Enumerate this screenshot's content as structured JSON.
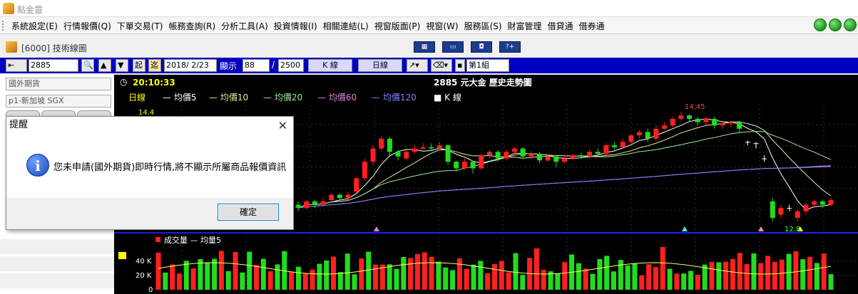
{
  "app": {
    "title": "點金靈"
  },
  "menu": {
    "items": [
      "系統設定(E)",
      "行情報價(Q)",
      "下單交易(T)",
      "帳務查詢(R)",
      "分析工具(A)",
      "投資情報(I)",
      "相關連結(L)",
      "視窗版面(P)",
      "視窗(W)",
      "服務區(S)",
      "財富管理",
      "借貸通",
      "借券通"
    ]
  },
  "window": {
    "title": "[6000] 技術線圖"
  },
  "toolbar": {
    "symbol": "2885",
    "btn_start": "起",
    "btn_recent": "迄",
    "date": "2018/ 2/23",
    "display_label": "顯示",
    "display_count": "88",
    "slash": "/",
    "total": "2500",
    "kline_label": "K 線",
    "period_label": "日線",
    "group_label": "第1組"
  },
  "left_panel": {
    "market_select": "國外期貨",
    "contract_select": "p1-新加坡 SGX",
    "tabs": [
      "",
      "",
      ""
    ]
  },
  "chart_header": {
    "time": "20:10:33",
    "title": "2885 元大金  歷史走勢圖",
    "legend_period": "日線",
    "legend_items": [
      {
        "label": "— 均價5",
        "color": "#ffffff"
      },
      {
        "label": "— 均價10",
        "color": "#e8e8a0"
      },
      {
        "label": "— 均價20",
        "color": "#a0e8a0"
      },
      {
        "label": "— 均價60",
        "color": "#e080e0"
      },
      {
        "label": "— 均價120",
        "color": "#8080ff"
      },
      {
        "label": "■ K 線",
        "color": "#ffffff"
      }
    ],
    "y_top": "14.4",
    "high_label": "14.45",
    "low_label": "12.8"
  },
  "volume_panel": {
    "legend": "成交量 — 均量5",
    "ticks": [
      "40 K",
      "20 K",
      "0"
    ]
  },
  "chart_data": {
    "type": "candlestick",
    "title": "2885 元大金  歷史走勢圖",
    "price_high_label": 14.45,
    "price_low_label": 12.8,
    "y_top_tick": 14.4,
    "volume_ticks": [
      "40 K",
      "20 K",
      "0"
    ],
    "candles": [
      {
        "o": 13.05,
        "c": 13.0,
        "h": 13.1,
        "l": 12.95
      },
      {
        "o": 13.0,
        "c": 13.1,
        "h": 13.12,
        "l": 12.98
      },
      {
        "o": 13.1,
        "c": 13.05,
        "h": 13.12,
        "l": 13.0
      },
      {
        "o": 13.05,
        "c": 13.1,
        "h": 13.15,
        "l": 13.02
      },
      {
        "o": 13.12,
        "c": 13.2,
        "h": 13.22,
        "l": 13.1
      },
      {
        "o": 13.2,
        "c": 13.15,
        "h": 13.22,
        "l": 13.1
      },
      {
        "o": 13.15,
        "c": 13.2,
        "h": 13.24,
        "l": 13.12
      },
      {
        "o": 13.25,
        "c": 13.45,
        "h": 13.47,
        "l": 13.22
      },
      {
        "o": 13.45,
        "c": 13.7,
        "h": 13.75,
        "l": 13.42
      },
      {
        "o": 13.7,
        "c": 13.9,
        "h": 13.95,
        "l": 13.65
      },
      {
        "o": 13.9,
        "c": 14.05,
        "h": 14.08,
        "l": 13.88
      },
      {
        "o": 14.05,
        "c": 13.85,
        "h": 14.08,
        "l": 13.8
      },
      {
        "o": 13.85,
        "c": 13.78,
        "h": 13.88,
        "l": 13.72
      },
      {
        "o": 13.75,
        "c": 13.85,
        "h": 13.88,
        "l": 13.72
      },
      {
        "o": 13.85,
        "c": 13.9,
        "h": 13.95,
        "l": 13.82
      },
      {
        "o": 13.9,
        "c": 13.92,
        "h": 13.98,
        "l": 13.88
      },
      {
        "o": 13.92,
        "c": 13.9,
        "h": 13.98,
        "l": 13.86
      },
      {
        "o": 13.9,
        "c": 13.95,
        "h": 14.0,
        "l": 13.86
      },
      {
        "o": 13.95,
        "c": 13.7,
        "h": 13.96,
        "l": 13.65
      },
      {
        "o": 13.7,
        "c": 13.6,
        "h": 13.72,
        "l": 13.55
      },
      {
        "o": 13.6,
        "c": 13.7,
        "h": 13.75,
        "l": 13.58
      },
      {
        "o": 13.7,
        "c": 13.6,
        "h": 13.72,
        "l": 13.52
      },
      {
        "o": 13.6,
        "c": 13.8,
        "h": 13.82,
        "l": 13.58
      },
      {
        "o": 13.8,
        "c": 13.85,
        "h": 13.88,
        "l": 13.75
      },
      {
        "o": 13.85,
        "c": 13.75,
        "h": 13.88,
        "l": 13.7
      },
      {
        "o": 13.75,
        "c": 13.85,
        "h": 13.88,
        "l": 13.72
      },
      {
        "o": 13.85,
        "c": 13.9,
        "h": 13.92,
        "l": 13.8
      },
      {
        "o": 13.9,
        "c": 13.78,
        "h": 13.92,
        "l": 13.74
      },
      {
        "o": 13.78,
        "c": 13.82,
        "h": 13.86,
        "l": 13.74
      },
      {
        "o": 13.82,
        "c": 13.72,
        "h": 13.85,
        "l": 13.68
      },
      {
        "o": 13.72,
        "c": 13.78,
        "h": 13.82,
        "l": 13.7
      },
      {
        "o": 13.78,
        "c": 13.7,
        "h": 13.8,
        "l": 13.62
      },
      {
        "o": 13.7,
        "c": 13.75,
        "h": 13.8,
        "l": 13.68
      },
      {
        "o": 13.75,
        "c": 13.8,
        "h": 13.82,
        "l": 13.72
      },
      {
        "o": 13.8,
        "c": 13.78,
        "h": 13.84,
        "l": 13.74
      },
      {
        "o": 13.78,
        "c": 13.85,
        "h": 13.88,
        "l": 13.75
      },
      {
        "o": 13.85,
        "c": 13.82,
        "h": 13.9,
        "l": 13.78
      },
      {
        "o": 13.82,
        "c": 13.95,
        "h": 13.98,
        "l": 13.8
      },
      {
        "o": 13.95,
        "c": 13.92,
        "h": 14.0,
        "l": 13.88
      },
      {
        "o": 13.92,
        "c": 14.0,
        "h": 14.05,
        "l": 13.9
      },
      {
        "o": 14.0,
        "c": 14.1,
        "h": 14.12,
        "l": 13.98
      },
      {
        "o": 14.1,
        "c": 14.15,
        "h": 14.18,
        "l": 14.05
      },
      {
        "o": 14.15,
        "c": 14.05,
        "h": 14.2,
        "l": 14.0
      },
      {
        "o": 14.05,
        "c": 14.2,
        "h": 14.25,
        "l": 14.02
      },
      {
        "o": 14.2,
        "c": 14.25,
        "h": 14.3,
        "l": 14.18
      },
      {
        "o": 14.25,
        "c": 14.35,
        "h": 14.38,
        "l": 14.22
      },
      {
        "o": 14.35,
        "c": 14.4,
        "h": 14.45,
        "l": 14.32
      },
      {
        "o": 14.4,
        "c": 14.35,
        "h": 14.42,
        "l": 14.3
      },
      {
        "o": 14.35,
        "c": 14.3,
        "h": 14.38,
        "l": 14.25
      },
      {
        "o": 14.3,
        "c": 14.35,
        "h": 14.38,
        "l": 14.26
      },
      {
        "o": 14.35,
        "c": 14.25,
        "h": 14.38,
        "l": 14.2
      },
      {
        "o": 14.25,
        "c": 14.28,
        "h": 14.3,
        "l": 14.2
      },
      {
        "o": 14.28,
        "c": 14.3,
        "h": 14.32,
        "l": 14.22
      },
      {
        "o": 14.3,
        "c": 14.2,
        "h": 14.32,
        "l": 14.15
      },
      {
        "o": 14.0,
        "c": 14.0,
        "h": 14.02,
        "l": 13.95
      },
      {
        "o": 13.98,
        "c": 13.98,
        "h": 14.0,
        "l": 13.9
      },
      {
        "o": 13.75,
        "c": 13.75,
        "h": 13.8,
        "l": 13.7
      },
      {
        "o": 13.1,
        "c": 12.85,
        "h": 13.15,
        "l": 12.8
      },
      {
        "o": 12.9,
        "c": 13.0,
        "h": 13.05,
        "l": 12.85
      },
      {
        "o": 13.0,
        "c": 13.0,
        "h": 13.05,
        "l": 12.95
      },
      {
        "o": 12.85,
        "c": 12.95,
        "h": 12.98,
        "l": 12.8
      },
      {
        "o": 12.95,
        "c": 13.05,
        "h": 13.08,
        "l": 12.9
      },
      {
        "o": 13.05,
        "c": 13.1,
        "h": 13.12,
        "l": 13.0
      },
      {
        "o": 13.1,
        "c": 13.05,
        "h": 13.12,
        "l": 13.0
      },
      {
        "o": 13.05,
        "c": 13.12,
        "h": 13.15,
        "l": 13.02
      }
    ]
  }
}
